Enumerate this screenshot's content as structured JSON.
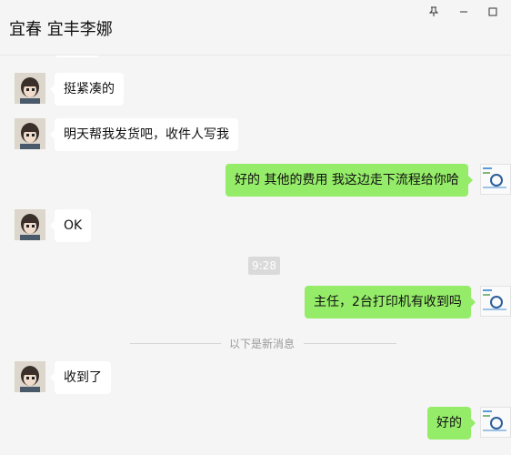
{
  "window": {
    "title": "宜春 宜丰李娜"
  },
  "messages": [
    {
      "side": "in",
      "text": "挺紧凑的"
    },
    {
      "side": "in",
      "text": "明天帮我发货吧，收件人写我"
    },
    {
      "side": "out",
      "text": "好的  其他的费用 我这边走下流程给你哈"
    },
    {
      "side": "in",
      "text": "OK"
    },
    {
      "side": "out",
      "text": "主任，2台打印机有收到吗"
    },
    {
      "side": "in",
      "text": "收到了"
    },
    {
      "side": "out",
      "text": "好的"
    }
  ],
  "time_separator": "9:28",
  "new_messages_divider": "以下是新消息",
  "colors": {
    "bubble_out": "#95ec69",
    "bubble_in": "#ffffff",
    "background": "#f5f5f5"
  },
  "icons": {
    "pin": "pin-icon",
    "minimize": "minimize-icon",
    "maximize": "maximize-icon"
  }
}
